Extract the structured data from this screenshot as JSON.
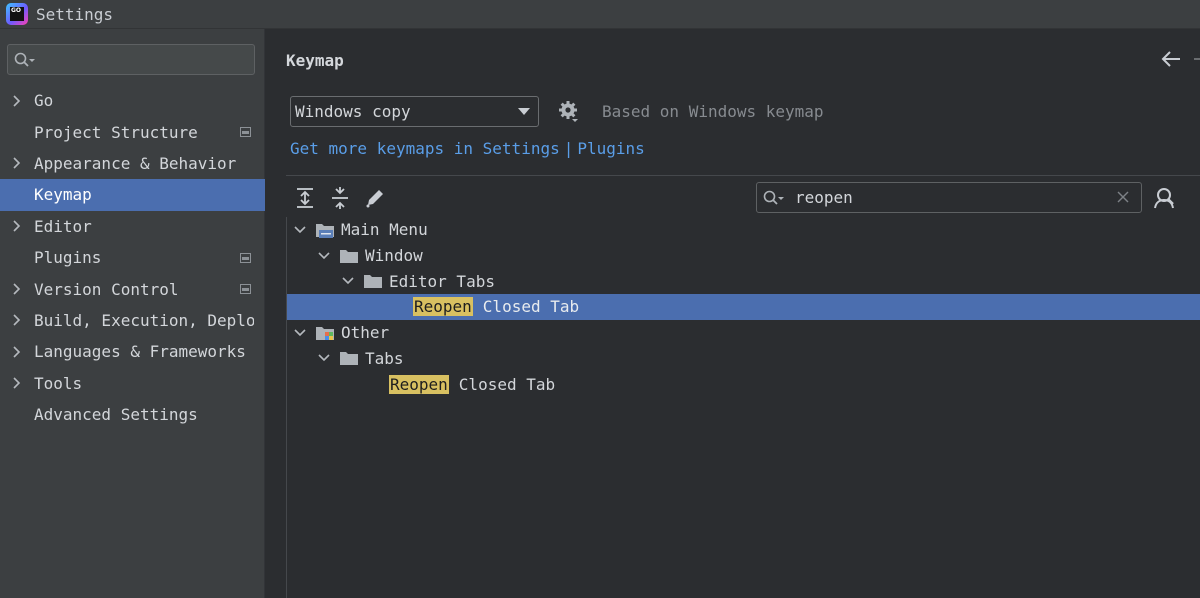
{
  "window": {
    "title": "Settings"
  },
  "sidebar": {
    "search": {
      "value": "",
      "placeholder": ""
    },
    "items": [
      {
        "label": "Go",
        "expandable": true,
        "badge": false,
        "selected": false
      },
      {
        "label": "Project Structure",
        "expandable": false,
        "badge": true,
        "selected": false
      },
      {
        "label": "Appearance & Behavior",
        "expandable": true,
        "badge": false,
        "selected": false
      },
      {
        "label": "Keymap",
        "expandable": false,
        "badge": false,
        "selected": true
      },
      {
        "label": "Editor",
        "expandable": true,
        "badge": false,
        "selected": false
      },
      {
        "label": "Plugins",
        "expandable": false,
        "badge": true,
        "selected": false
      },
      {
        "label": "Version Control",
        "expandable": true,
        "badge": true,
        "selected": false
      },
      {
        "label": "Build, Execution, Deplo",
        "expandable": true,
        "badge": false,
        "selected": false
      },
      {
        "label": "Languages & Frameworks",
        "expandable": true,
        "badge": false,
        "selected": false
      },
      {
        "label": "Tools",
        "expandable": true,
        "badge": false,
        "selected": false
      },
      {
        "label": "Advanced Settings",
        "expandable": false,
        "badge": false,
        "selected": false
      }
    ]
  },
  "main": {
    "title": "Keymap",
    "keymap_select": {
      "value": "Windows copy"
    },
    "based_on": "Based on Windows keymap",
    "links": {
      "get_more": "Get more keymaps in Settings",
      "separator": "|",
      "plugins": "Plugins"
    },
    "tree_search": {
      "value": "reopen",
      "placeholder": ""
    },
    "tree": [
      {
        "label": "Main Menu",
        "level": 0,
        "kind": "main-menu",
        "expanded": true
      },
      {
        "label": "Window",
        "level": 1,
        "kind": "folder",
        "expanded": true
      },
      {
        "label": "Editor Tabs",
        "level": 2,
        "kind": "folder",
        "expanded": true
      },
      {
        "highlight": "Reopen",
        "rest": "Closed Tab",
        "level": 3,
        "kind": "action",
        "selected": true
      },
      {
        "label": "Other",
        "level": 0,
        "kind": "other",
        "expanded": true
      },
      {
        "label": "Tabs",
        "level": 1,
        "kind": "folder",
        "expanded": true
      },
      {
        "highlight": "Reopen",
        "rest": "Closed Tab",
        "level": 2,
        "kind": "action",
        "selected": false
      }
    ]
  },
  "colors": {
    "sidebar_bg": "#3c3f41",
    "main_bg": "#2b2d30",
    "selection": "#4b6eaf",
    "link": "#5a9ee8",
    "match_highlight": "#d8c061"
  }
}
